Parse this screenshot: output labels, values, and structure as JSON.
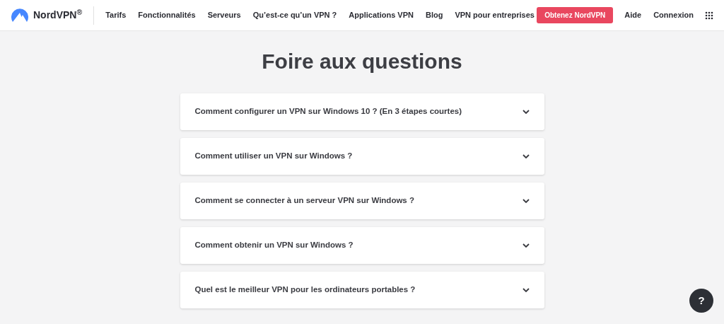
{
  "header": {
    "logo": "NordVPN$^{®}$",
    "nav": [
      "Tarifs",
      "Fonctionnalités",
      "Serveurs",
      "Qu’est-ce qu’un VPN ?",
      "Applications VPN",
      "Blog",
      "VPN pour entreprises"
    ],
    "cta": "Obtenez NordVPN",
    "links": [
      "Aide",
      "Connexion"
    ]
  },
  "faq": {
    "title": "Foire aux questions",
    "items": [
      {
        "question": "Comment configurer un VPN sur Windows 10 ? (En 3 étapes courtes)",
        "expanded": false
      },
      {
        "question": "Comment utiliser un VPN sur Windows ?",
        "expanded": false
      },
      {
        "question": "Comment se connecter à un serveur VPN sur Windows ?",
        "expanded": false
      },
      {
        "question": "Comment obtenir un VPN sur Windows ?",
        "expanded": false
      },
      {
        "question": "Quel est le meilleur VPN pour les ordinateurs portables ?",
        "expanded": false
      }
    ]
  },
  "help_button": {
    "label": "?"
  }
}
